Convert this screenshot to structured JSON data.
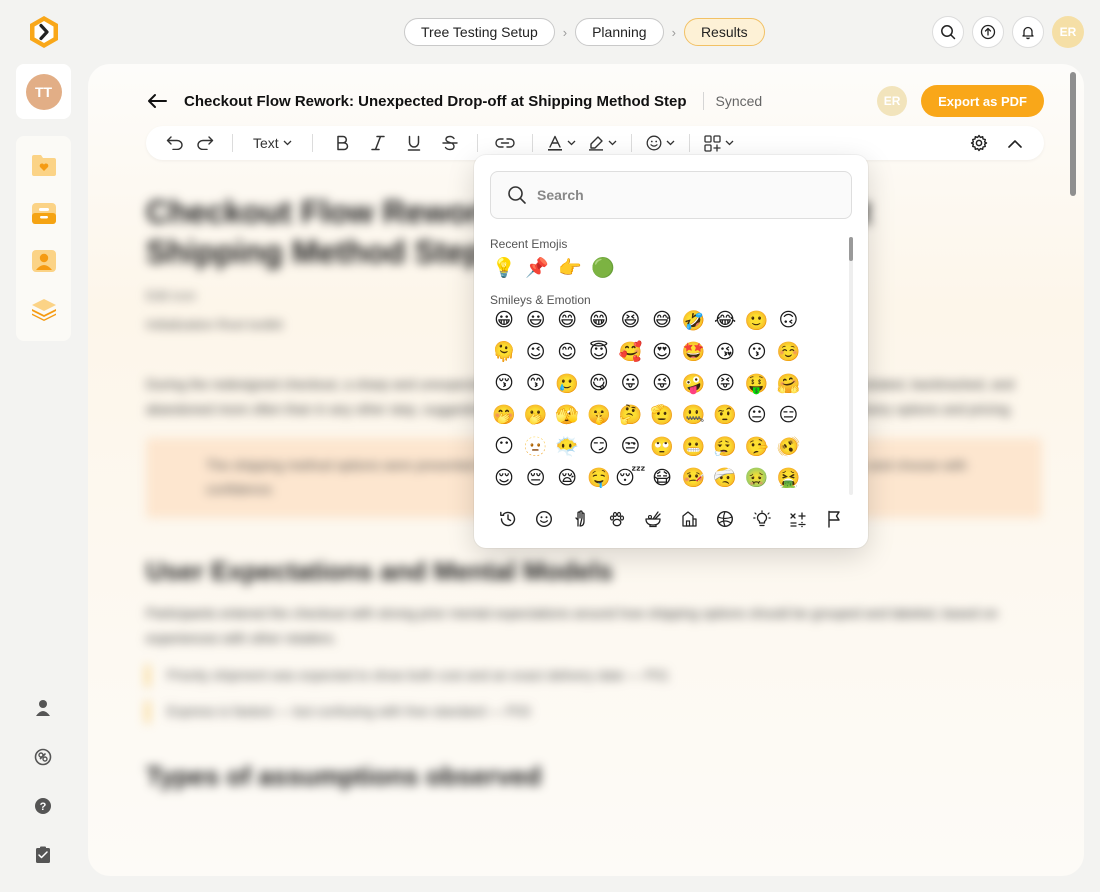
{
  "app": {
    "logo_icon": "chevron-hexagon-logo",
    "accent": "#f9a719"
  },
  "steps": [
    {
      "label": "Tree Testing Setup"
    },
    {
      "label": "Planning"
    },
    {
      "label": "Results"
    }
  ],
  "top_user_initials": "ER",
  "sidebar": {
    "user_initials": "TT",
    "nav_icons": [
      "folder-heart-icon",
      "inbox-icon",
      "user-card-icon",
      "layers-icon"
    ],
    "bottom_icons": [
      "person-icon",
      "link-icon",
      "help-icon",
      "clipboard-icon"
    ]
  },
  "doc": {
    "title": "Checkout Flow Rework: Unexpected Drop-off at Shipping Method Step",
    "status": "Synced",
    "collaborator_initials": "ER",
    "export_label": "Export as PDF"
  },
  "toolbar": {
    "text_style_label": "Text"
  },
  "body": {
    "heading": "Checkout Flow Rework: Unexpected Drop-off at Shipping Method Step",
    "meta_author": "Edit icon",
    "meta_tags": "Initialization Root toolkit",
    "paragraph": "During the redesigned checkout, a sharp and unexpected drop-off occurred at the Shipping Method step. Participants hesitated, backtracked, and abandoned more often than in any other step, suggesting the labels and grouping did not match their expectations of delivery options and pricing.",
    "callout": "The shipping method options were presented without delivery dates, making it hard for participants to compare and choose with confidence.",
    "section_heading": "User Expectations and Mental Models",
    "section_paragraph": "Participants entered the checkout with strong prior mental expectations around how shipping options should be grouped and labeled, based on experiences with other retailers.",
    "list": [
      "Priority shipment was expected to show both cost and an exact delivery date — P01",
      "Express is fastest — but confusing with free standard — P03"
    ],
    "section_heading_2": "Types of assumptions observed"
  },
  "emoji_picker": {
    "search_placeholder": "Search",
    "recent_label": "Recent Emojis",
    "smileys_label": "Smileys & Emotion",
    "recent": [
      "💡",
      "📌",
      "👉",
      "🟢"
    ],
    "smileys": [
      "😀",
      "😃",
      "😄",
      "😁",
      "😆",
      "😅",
      "🤣",
      "😂",
      "🙂",
      "🙃",
      "🫠",
      "😉",
      "😊",
      "😇",
      "🥰",
      "😍",
      "🤩",
      "😘",
      "😗",
      "☺️",
      "😚",
      "😙",
      "🥲",
      "😋",
      "😛",
      "😜",
      "🤪",
      "😝",
      "🤑",
      "🤗",
      "🤭",
      "🫢",
      "🫣",
      "🤫",
      "🤔",
      "🫡",
      "🤐",
      "🤨",
      "😐",
      "😑",
      "😶",
      "🫥",
      "😶‍🌫️",
      "😏",
      "😒",
      "🙄",
      "😬",
      "😮‍💨",
      "🤥",
      "🫨",
      "😌",
      "😔",
      "😪",
      "🤤",
      "😴",
      "😷",
      "🤒",
      "🤕",
      "🤢",
      "🤮",
      "🤧",
      "🥵",
      "🥶",
      "🥴",
      "😵",
      "😵‍💫"
    ],
    "categories": [
      "recent-clock-icon",
      "smiley-icon",
      "hand-icon",
      "paw-icon",
      "food-bowl-icon",
      "building-icon",
      "ball-icon",
      "lightbulb-icon",
      "symbols-icon",
      "flag-icon"
    ]
  }
}
